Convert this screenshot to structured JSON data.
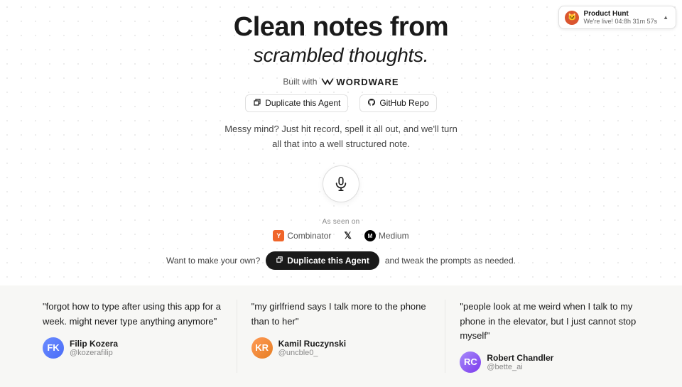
{
  "ph_badge": {
    "title": "Product Hunt",
    "subtitle": "We're live!",
    "timer": "04:8h 31m 57s",
    "arrow": "▲"
  },
  "hero": {
    "line1": "Clean notes from",
    "line2": "scrambled thoughts."
  },
  "built_with": {
    "label": "Built with",
    "brand": "WORDWARE"
  },
  "links": {
    "duplicate": "Duplicate this Agent",
    "github": "GitHub Repo"
  },
  "description": {
    "text": "Messy mind? Just hit record, spell it all out, and we'll turn all that into a well structured note."
  },
  "as_seen": {
    "label": "As seen on",
    "logos": [
      {
        "name": "Combinator",
        "icon": "Y"
      },
      {
        "name": "X",
        "icon": "X"
      },
      {
        "name": "Medium",
        "icon": "M"
      }
    ]
  },
  "cta": {
    "prefix": "Want to make your own?",
    "button_label": "Duplicate this Agent",
    "suffix": "and tweak the prompts as needed."
  },
  "testimonials": [
    {
      "quote": "\"forgot how to type after using this app for a week. might never type anything anymore\"",
      "name": "Filip Kozera",
      "handle": "@kozerafilip",
      "avatar_initials": "FK"
    },
    {
      "quote": "\"my girlfriend says I talk more to the phone than to her\"",
      "name": "Kamil Ruczynski",
      "handle": "@uncble0_",
      "avatar_initials": "KR"
    },
    {
      "quote": "\"people look at me weird when I talk to my phone in the elevator, but I just cannot stop myself\"",
      "name": "Robert Chandler",
      "handle": "@bette_ai",
      "avatar_initials": "RC"
    }
  ]
}
